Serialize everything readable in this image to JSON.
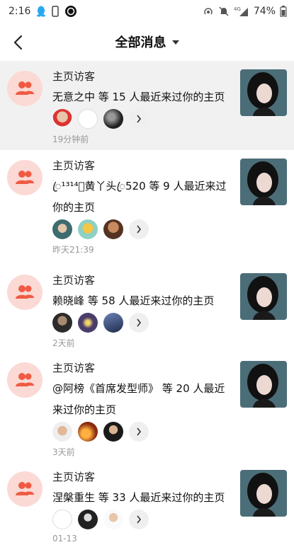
{
  "status_bar": {
    "time": "2:16",
    "battery": "74%",
    "network": "4G"
  },
  "header": {
    "title": "全部消息"
  },
  "colors": {
    "accent": "#f05a43",
    "icon_bg": "#fbd9d4"
  },
  "messages": [
    {
      "title": "主页访客",
      "text": "无意之中 等 15 人最近来过你的主页",
      "time": "19分钟前"
    },
    {
      "title": "主页访客",
      "text": "ꦿ¹³¹⁴ꦿ黄丫头ꦿ520 等 9 人最近来过你的主页",
      "time": "昨天21:39"
    },
    {
      "title": "主页访客",
      "text": "赖晓峰 等 58 人最近来过你的主页",
      "time": "2天前"
    },
    {
      "title": "主页访客",
      "text": "@阿榜《首席发型师》 等 20 人最近来过你的主页",
      "time": "3天前"
    },
    {
      "title": "主页访客",
      "text": "涅槃重生 等 33 人最近来过你的主页",
      "time": "01-13"
    }
  ]
}
